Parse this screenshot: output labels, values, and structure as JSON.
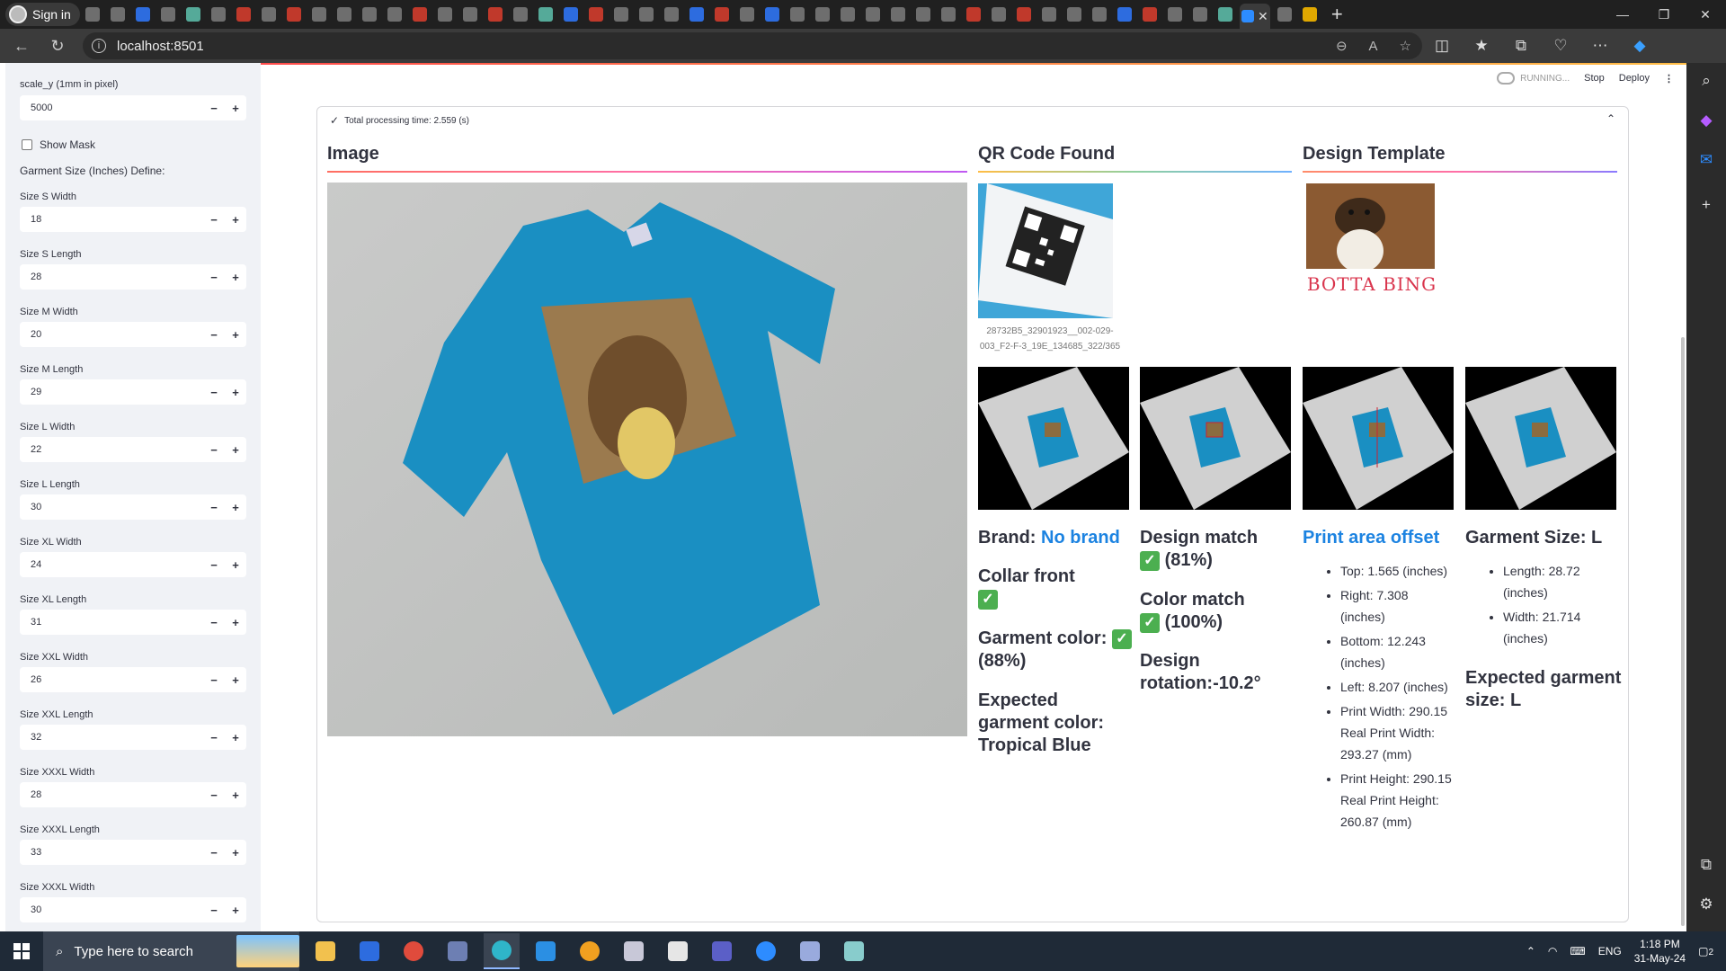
{
  "browser": {
    "signin_label": "Sign in",
    "url": "localhost:8501"
  },
  "topbar": {
    "running_label": "RUNNING...",
    "stop_label": "Stop",
    "deploy_label": "Deploy"
  },
  "sidebar": {
    "scale_label": "scale_y (1mm in pixel)",
    "scale_value": "5000",
    "show_mask_label": "Show Mask",
    "garment_title": "Garment Size (Inches) Define:",
    "fields": [
      {
        "label": "Size S Width",
        "value": "18"
      },
      {
        "label": "Size S Length",
        "value": "28"
      },
      {
        "label": "Size M Width",
        "value": "20"
      },
      {
        "label": "Size M Length",
        "value": "29"
      },
      {
        "label": "Size L Width",
        "value": "22"
      },
      {
        "label": "Size L Length",
        "value": "30"
      },
      {
        "label": "Size XL Width",
        "value": "24"
      },
      {
        "label": "Size XL Length",
        "value": "31"
      },
      {
        "label": "Size XXL Width",
        "value": "26"
      },
      {
        "label": "Size XXL Length",
        "value": "32"
      },
      {
        "label": "Size XXXL Width",
        "value": "28"
      },
      {
        "label": "Size XXXL Length",
        "value": "33"
      },
      {
        "label": "Size XXXL Width",
        "value": "30"
      }
    ]
  },
  "main": {
    "status": "Total processing time: 2.559 (s)",
    "image_header": "Image",
    "qr_header": "QR Code Found",
    "qr_caption": "28732B5_32901923__002-029-003_F2-F-3_19E_134685_322/365",
    "template_header": "Design Template",
    "template_logo_text": "BOTTA BING",
    "brand_label": "Brand:",
    "brand_value": "No brand",
    "collar_label": "Collar front",
    "garment_color_label": "Garment color:",
    "garment_color_pct": "(88%)",
    "expected_color": "Expected garment color: Tropical Blue",
    "design_match_label": "Design match",
    "design_match_pct": "(81%)",
    "color_match_label": "Color match",
    "color_match_pct": "(100%)",
    "design_rotation": "Design rotation:-10.2°",
    "print_offset_title": "Print area offset",
    "print_offset_items": [
      "Top: 1.565 (inches)",
      "Right: 7.308 (inches)",
      "Bottom: 12.243 (inches)",
      "Left: 8.207 (inches)",
      "Print Width: 290.15 Real Print Width: 293.27 (mm)",
      "Print Height: 290.15 Real Print Height: 260.87 (mm)"
    ],
    "garment_size_title": "Garment Size: L",
    "garment_size_items": [
      "Length: 28.72 (inches)",
      "Width: 21.714 (inches)"
    ],
    "expected_size": "Expected garment size: L"
  },
  "taskbar": {
    "search_placeholder": "Type here to search",
    "language": "ENG",
    "time": "1:18 PM",
    "date": "31-May-24",
    "notifications": "2"
  },
  "colors": {
    "accent_blue": "#1c83e1",
    "shirt_blue": "#1a8fc2",
    "check_green": "#4caf50"
  }
}
